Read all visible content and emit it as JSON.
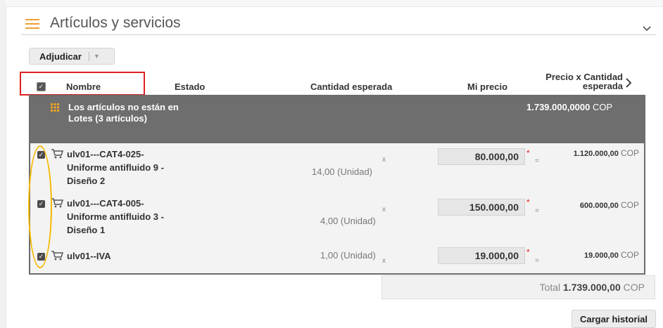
{
  "section": {
    "title": "Artículos y servicios"
  },
  "toolbar": {
    "adjudicar_label": "Adjudicar"
  },
  "table_headers": {
    "nombre": "Nombre",
    "estado": "Estado",
    "cantidad": "Cantidad esperada",
    "mi_precio": "Mi precio",
    "precio_x_cantidad_1": "Precio x Cantidad",
    "precio_x_cantidad_2": "esperada"
  },
  "group": {
    "line1": "Los artículos no están en",
    "line2": "Lotes (3 artículos)",
    "total_value": "1.739.000,0000",
    "total_currency": "COP"
  },
  "items": [
    {
      "line1": "ulv01---CAT4-025-",
      "line2": "Uniforme antifluido 9 -",
      "line3": "Diseño 2",
      "qty": "14,00 (Unidad)",
      "price": "80.000,00",
      "total": "1.120.000,00",
      "currency": "COP",
      "checked": true
    },
    {
      "line1": "ulv01---CAT4-005-",
      "line2": "Uniforme antifluido 3 -",
      "line3": "Diseño 1",
      "qty": "4,00 (Unidad)",
      "price": "150.000,00",
      "total": "600.000,00",
      "currency": "COP",
      "checked": true
    },
    {
      "line1": "ulv01--IVA",
      "line2": "",
      "line3": "",
      "qty": "1,00 (Unidad)",
      "price": "19.000,00",
      "total": "19.000,00",
      "currency": "COP",
      "checked": true
    }
  ],
  "signs": {
    "times": "x",
    "equals": "=",
    "required": "*",
    "check": "✓"
  },
  "footer": {
    "total_label": "Total",
    "total_value": "1.739.000,00",
    "total_currency": "COP"
  },
  "history_button": "Cargar historial",
  "colors": {
    "accent_orange": "#f0a030",
    "highlight_red": "#e02020",
    "highlight_yellow": "#f5b800",
    "group_bg": "#6e6e6e"
  }
}
